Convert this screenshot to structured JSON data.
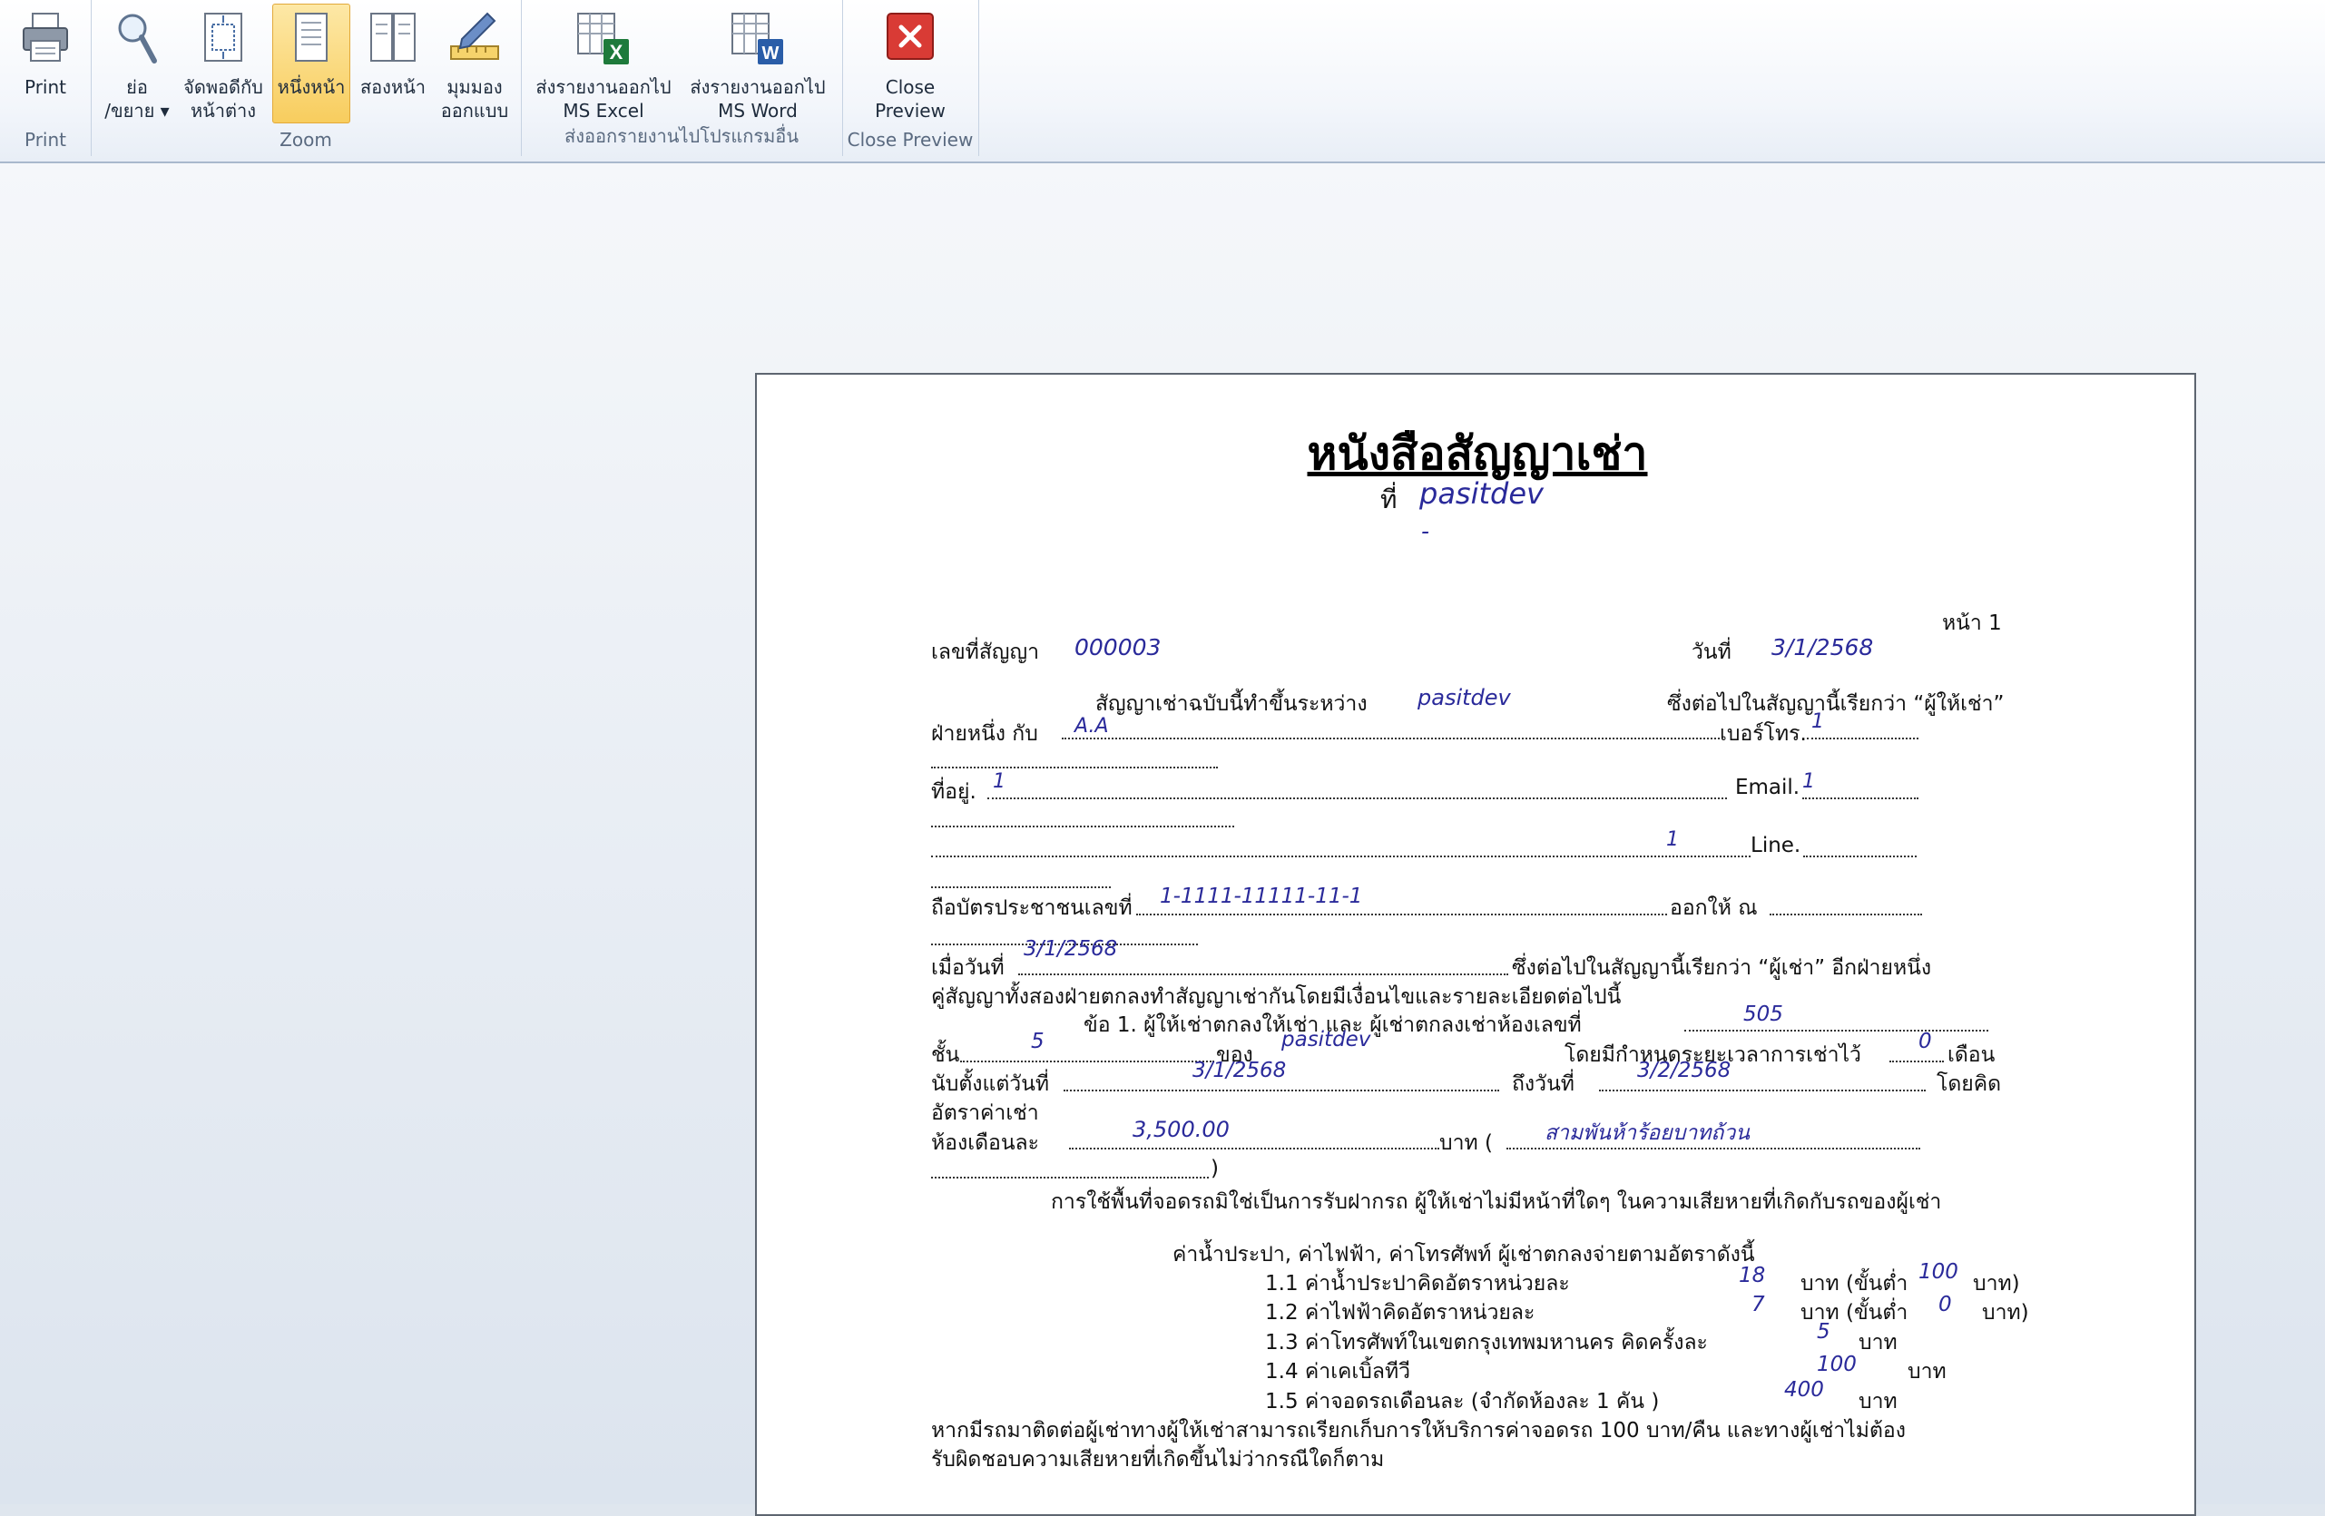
{
  "ribbon": {
    "groups": [
      {
        "label": "Print"
      },
      {
        "label": "Zoom"
      },
      {
        "label": "ส่งออกรายงานไปโปรแกรมอื่น"
      },
      {
        "label": "Close Preview"
      }
    ],
    "buttons": {
      "print": "Print",
      "zoom": "ย่อ\n/ขยาย ▾",
      "fit_window": "จัดพอดีกับ\nหน้าต่าง",
      "one_page": "หนึ่งหน้า",
      "two_pages": "สองหน้า",
      "design_view": "มุมมอง\nออกแบบ",
      "export_excel": "ส่งรายงานออกไป\nMS Excel",
      "export_word": "ส่งรายงานออกไป\nMS Word",
      "close_preview": "Close\nPreview"
    },
    "active_button": "one_page"
  },
  "document": {
    "title": "หนังสือสัญญาเช่า",
    "at_label": "ที่",
    "at_value": "pasitdev",
    "dash": "-",
    "page_label": "หน้า 1",
    "contract_no_label": "เลขที่สัญญา",
    "contract_no": "000003",
    "date_label": "วันที่",
    "date": "3/1/2568",
    "made_between": "สัญญาเช่าฉบับนี้ทำขึ้นระหว่าง",
    "lessor_name": "pasitdev",
    "lessor_called": "ซึ่งต่อไปในสัญญานี้เรียกว่า “ผู้ให้เช่า”",
    "party_one": "ฝ่ายหนึ่ง กับ",
    "lessee_name": "A.A",
    "phone_label": "เบอร์โทร.",
    "phone": "1",
    "address_label": "ที่อยู่.",
    "address": "1",
    "email_label": "Email.",
    "email": "1",
    "address_line2": "1",
    "line_label": "Line.",
    "id_label": "ถือบัตรประชาชนเลขที่",
    "id_no": "1-1111-11111-11-1",
    "issued_at": "ออกให้ ณ",
    "when_label": "เมื่อวันที่",
    "issue_date": "3/1/2568",
    "lessee_called": "ซึ่งต่อไปในสัญญานี้เรียกว่า “ผู้เช่า” อีกฝ่ายหนึ่ง",
    "agree_text": "คู่สัญญาทั้งสองฝ่ายตกลงทำสัญญาเช่ากันโดยมีเงื่อนไขและรายละเอียดต่อไปนี้",
    "clause1_text": "ข้อ 1.  ผู้ให้เช่าตกลงให้เช่า      และ ผู้เช่าตกลงเช่าห้องเลขที่",
    "room_no": "505",
    "floor_label": "ชั้น",
    "floor": "5",
    "of_label": "ของ",
    "building": "pasitdev",
    "period_label": "โดยมีกำหนดระยะเวลาการเช่าไว้",
    "months": "0",
    "month_unit": "เดือน",
    "from_label": "นับตั้งแต่วันที่",
    "from_date": "3/1/2568",
    "to_label": "ถึงวันที่",
    "to_date": "3/2/2568",
    "calc_label": "โดยคิด",
    "rate_label": "อัตราค่าเช่า",
    "monthly_label": "ห้องเดือนละ",
    "rent": "3,500.00",
    "baht_open": "บาท (",
    "rent_words": "สามพันห้าร้อยบาทถ้วน",
    "close_paren": ")",
    "parking_note": "การใช้พื้นที่จอดรถมิใช่เป็นการรับฝากรถ ผู้ให้เช่าไม่มีหน้าที่ใดๆ ในความเสียหายที่เกิดกับรถของผู้เช่า",
    "utilities_heading": "ค่าน้ำประปา,  ค่าไฟฟ้า,  ค่าโทรศัพท์  ผู้เช่าตกลงจ่ายตามอัตราดังนี้",
    "items": [
      {
        "label": "1.1  ค่าน้ำประปาคิดอัตราหน่วยละ",
        "value": "18",
        "unit": "บาท (ขั้นต่ำ",
        "min": "100",
        "min_unit": "บาท)"
      },
      {
        "label": "1.2  ค่าไฟฟ้าคิดอัตราหน่วยละ",
        "value": "7",
        "unit": "บาท (ขั้นต่ำ",
        "min": "0",
        "min_unit": "บาท)"
      },
      {
        "label": "1.3  ค่าโทรศัพท์ในเขตกรุงเทพมหานคร คิดครั้งละ",
        "value": "5",
        "unit": "บาท"
      },
      {
        "label": "1.4  ค่าเคเบิ้ลทีวี",
        "value": "100",
        "unit": "บาท"
      },
      {
        "label": "1.5 ค่าจอดรถเดือนละ (จำกัดห้องละ 1 คัน )",
        "value": "400",
        "unit": "บาท"
      }
    ],
    "footer1": "หากมีรถมาติดต่อผู้เช่าทางผู้ให้เช่าสามารถเรียกเก็บการให้บริการค่าจอดรถ 100 บาท/คืน และทางผู้เช่าไม่ต้อง",
    "footer2": "รับผิดชอบความเสียหายที่เกิดขึ้นไม่ว่ากรณีใดก็ตาม"
  }
}
